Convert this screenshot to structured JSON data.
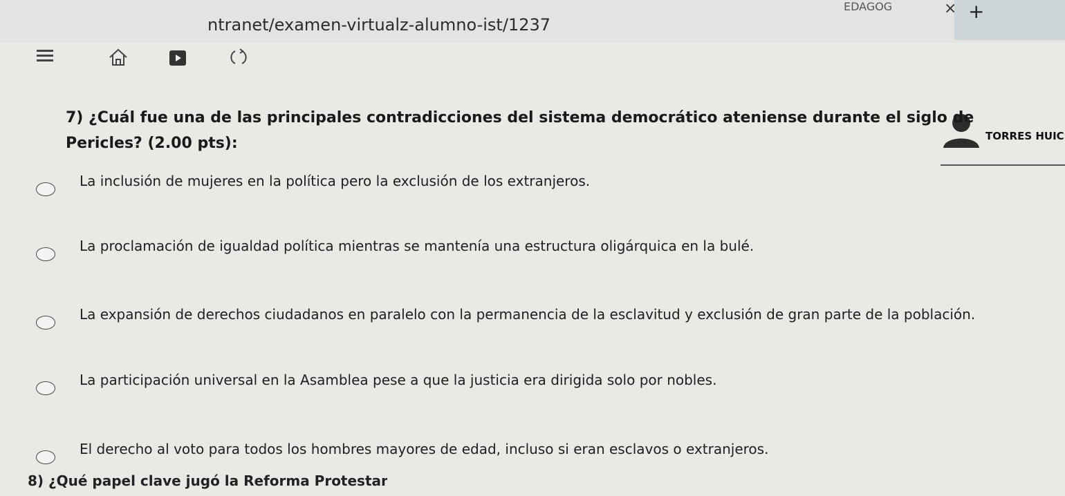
{
  "browser": {
    "url": "ntranet/examen-virtualz-alumno-ist/1237",
    "tab_label": "EDAGOG",
    "tab_close": "×",
    "new_tab": "+"
  },
  "user": {
    "name": "TORRES HUICH"
  },
  "question": {
    "number": "7)",
    "text": "¿Cuál fue una de las principales contradicciones del sistema democrático ateniense durante el siglo de Pericles? (2.00 pts):"
  },
  "options": [
    "La inclusión de mujeres en la política pero la exclusión de los extranjeros.",
    "La proclamación de igualdad política mientras se mantenía una estructura oligárquica en la bulé.",
    "La expansión de derechos ciudadanos en paralelo con la permanencia de la esclavitud y exclusión de gran parte de la población.",
    "La participación universal en la Asamblea pese a que la justicia era dirigida solo por nobles.",
    "El derecho al voto para todos los hombres mayores de edad, incluso si eran esclavos o extranjeros."
  ],
  "next_question": "8) ¿Qué papel clave jugó la Reforma Protestante",
  "icons": [
    "menu-icon",
    "home-icon",
    "play-icon",
    "refresh-icon",
    "user-avatar-icon"
  ]
}
